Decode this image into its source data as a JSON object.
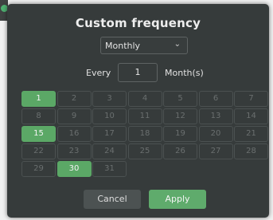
{
  "dialog": {
    "title": "Custom frequency",
    "frequency_select": {
      "value": "Monthly"
    },
    "interval": {
      "label": "Every",
      "value": "1",
      "unit": "Month(s)"
    },
    "days": [
      {
        "label": "1",
        "selected": true
      },
      {
        "label": "2",
        "selected": false
      },
      {
        "label": "3",
        "selected": false
      },
      {
        "label": "4",
        "selected": false
      },
      {
        "label": "5",
        "selected": false
      },
      {
        "label": "6",
        "selected": false
      },
      {
        "label": "7",
        "selected": false
      },
      {
        "label": "8",
        "selected": false
      },
      {
        "label": "9",
        "selected": false
      },
      {
        "label": "10",
        "selected": false
      },
      {
        "label": "11",
        "selected": false
      },
      {
        "label": "12",
        "selected": false
      },
      {
        "label": "13",
        "selected": false
      },
      {
        "label": "14",
        "selected": false
      },
      {
        "label": "15",
        "selected": true
      },
      {
        "label": "16",
        "selected": false
      },
      {
        "label": "17",
        "selected": false
      },
      {
        "label": "18",
        "selected": false
      },
      {
        "label": "19",
        "selected": false
      },
      {
        "label": "20",
        "selected": false
      },
      {
        "label": "21",
        "selected": false
      },
      {
        "label": "22",
        "selected": false
      },
      {
        "label": "23",
        "selected": false
      },
      {
        "label": "24",
        "selected": false
      },
      {
        "label": "25",
        "selected": false
      },
      {
        "label": "26",
        "selected": false
      },
      {
        "label": "27",
        "selected": false
      },
      {
        "label": "28",
        "selected": false
      },
      {
        "label": "29",
        "selected": false
      },
      {
        "label": "30",
        "selected": true
      },
      {
        "label": "31",
        "selected": false
      }
    ],
    "buttons": {
      "cancel_label": "Cancel",
      "apply_label": "Apply"
    }
  },
  "colors": {
    "dialog_background": "#363b3b",
    "selected_day": "#5ba866",
    "apply_button": "#5fab6c",
    "cancel_button": "#4c5252"
  },
  "icons": {
    "select_chevron": "chevron-down-icon"
  }
}
